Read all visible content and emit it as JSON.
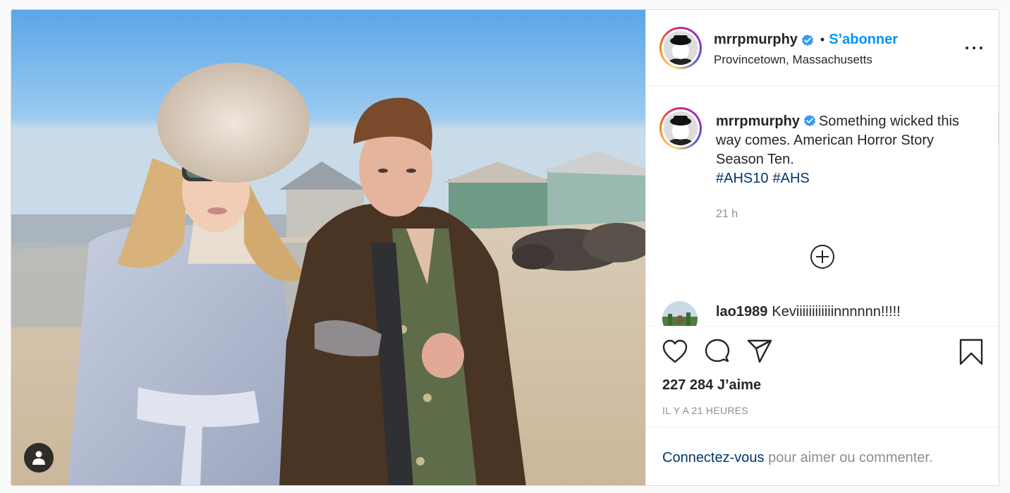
{
  "post": {
    "author": {
      "username": "mrrpmurphy",
      "verified": true,
      "follow_label": "S’abonner",
      "separator": "•",
      "location": "Provincetown, Massachusetts"
    },
    "caption": {
      "username": "mrrpmurphy",
      "text": "Something wicked this way comes. American Horror Story Season Ten.",
      "hashtags": [
        "#AHS10",
        "#AHS"
      ],
      "time_ago": "21 h"
    },
    "comments": [
      {
        "username": "lao1989",
        "text": "Keviiiiiiiiiiiinnnnnn!!!!!"
      }
    ],
    "likes_label": "227 284 J’aime",
    "date_label": "IL Y A 21 HEURES",
    "login_prompt": {
      "link": "Connectez-vous",
      "text": " pour aimer ou commenter."
    },
    "icons": {
      "verified": "verified-badge-icon",
      "more": "more-options-icon",
      "load_more": "plus-circle-icon",
      "like": "heart-icon",
      "comment": "comment-bubble-icon",
      "share": "paper-plane-icon",
      "save": "bookmark-icon",
      "tags": "user-tag-icon"
    },
    "colors": {
      "accent": "#0095f6",
      "link": "#00376b",
      "muted": "#8e8e8e",
      "verified": "#3897f0"
    }
  }
}
